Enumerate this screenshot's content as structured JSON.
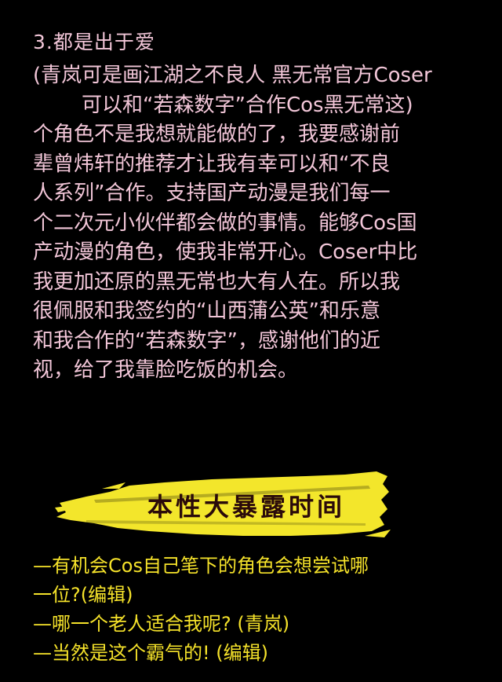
{
  "section": {
    "heading": "3.都是出于爱"
  },
  "paragraph": {
    "lines": [
      "(青岚可是画江湖之不良人 黑无常官方Coser",
      "可以和“若森数字”合作Cos黑无常这)",
      "个角色不是我想就能做的了，我要感谢前",
      "辈曾炜轩的推荐才让我有幸可以和“不良",
      "人系列”合作。支持国产动漫是我们每一",
      "个二次元小伙伴都会做的事情。能够Cos国",
      "产动漫的角色，使我非常开心。Coser中比",
      "我更加还原的黑无常也大有人在。所以我",
      "很佩服和我签约的“山西蒲公英”和乐意",
      "和我合作的“若森数字”，感谢他们的近",
      "视，给了我靠脸吃饭的机会。"
    ]
  },
  "banner": {
    "title": "本性大暴露时间",
    "colors": {
      "brush": "#f3e62b",
      "text": "#2a0a0a"
    }
  },
  "dialogue": {
    "lines": [
      "—有机会Cos自己笔下的角色会想尝试哪",
      "一位?(编辑)",
      "—哪一个老人适合我呢? (青岚)",
      "—当然是这个霸气的! (编辑)"
    ]
  },
  "colors": {
    "background": "#000000",
    "paragraph_text": "#f2c6d8",
    "dialogue_text": "#f5e22a"
  }
}
